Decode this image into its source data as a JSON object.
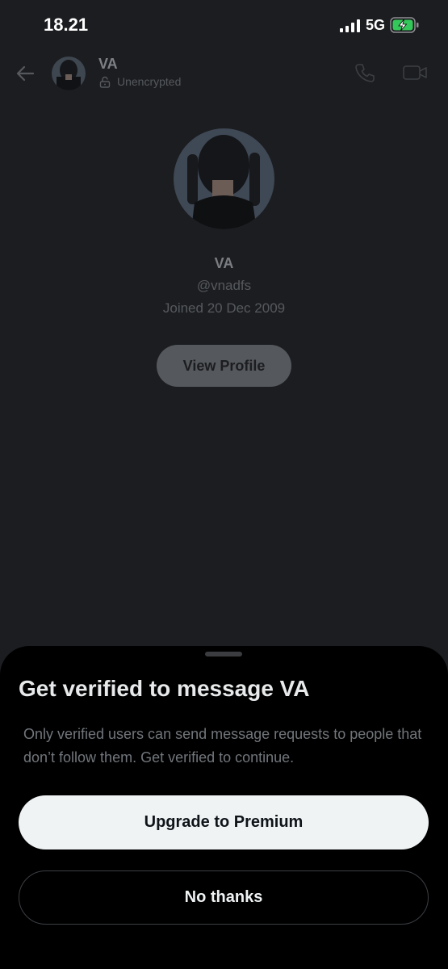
{
  "status_bar": {
    "time": "18.21",
    "network": "5G"
  },
  "header": {
    "name": "VA",
    "encryption": "Unencrypted"
  },
  "profile": {
    "name": "VA",
    "handle": "@vnadfs",
    "joined": "Joined 20 Dec 2009",
    "view_profile_label": "View Profile"
  },
  "sheet": {
    "title": "Get verified to message VA",
    "body": "Only verified users can send message requests to people that don’t follow them.  Get verified to continue.",
    "upgrade_label": "Upgrade to Premium",
    "no_thanks_label": "No thanks"
  },
  "icons": [
    "signal-icon",
    "battery-charging-icon",
    "back-arrow-icon",
    "lock-icon",
    "phone-icon",
    "video-icon"
  ],
  "colors": {
    "background": "#1c1d20",
    "sheet": "#000000",
    "primary_button": "#eff3f4",
    "battery_green": "#34c759"
  }
}
